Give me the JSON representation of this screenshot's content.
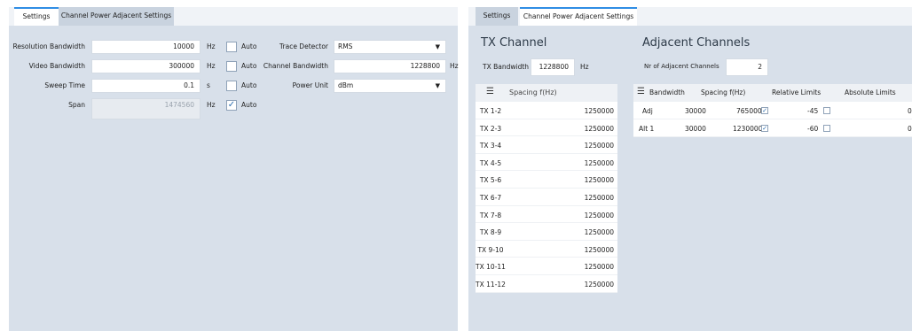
{
  "left": {
    "tabs": [
      "Settings",
      "Channel Power Adjacent Settings"
    ],
    "rbw": {
      "label": "Resolution Bandwidth",
      "value": "10000",
      "unit": "Hz",
      "auto_label": "Auto"
    },
    "vbw": {
      "label": "Video Bandwidth",
      "value": "300000",
      "unit": "Hz",
      "auto_label": "Auto"
    },
    "sweep": {
      "label": "Sweep Time",
      "value": "0.1",
      "unit": "s",
      "auto_label": "Auto"
    },
    "span": {
      "label": "Span",
      "value": "1474560",
      "unit": "Hz",
      "auto_label": "Auto"
    },
    "trace_detector": {
      "label": "Trace Detector",
      "value": "RMS"
    },
    "channel_bw": {
      "label": "Channel Bandwidth",
      "value": "1228800",
      "unit": "Hz"
    },
    "power_unit": {
      "label": "Power Unit",
      "value": "dBm"
    }
  },
  "right": {
    "tabs": [
      "Settings",
      "Channel Power Adjacent Settings"
    ],
    "tx_channel": {
      "title": "TX Channel",
      "bw_label": "TX Bandwidth",
      "bw_value": "1228800",
      "bw_unit": "Hz"
    },
    "adjacent": {
      "title": "Adjacent Channels",
      "nr_label": "Nr of Adjacent Channels",
      "nr_value": "2"
    },
    "tx_table": {
      "header": "Spacing f(Hz)",
      "rows": [
        {
          "name": "TX 1-2",
          "value": "1250000"
        },
        {
          "name": "TX 2-3",
          "value": "1250000"
        },
        {
          "name": "TX 3-4",
          "value": "1250000"
        },
        {
          "name": "TX 4-5",
          "value": "1250000"
        },
        {
          "name": "TX 5-6",
          "value": "1250000"
        },
        {
          "name": "TX 6-7",
          "value": "1250000"
        },
        {
          "name": "TX 7-8",
          "value": "1250000"
        },
        {
          "name": "TX 8-9",
          "value": "1250000"
        },
        {
          "name": "TX 9-10",
          "value": "1250000"
        },
        {
          "name": "TX 10-11",
          "value": "1250000"
        },
        {
          "name": "TX 11-12",
          "value": "1250000"
        }
      ]
    },
    "adj_table": {
      "headers": [
        "Bandwidth",
        "Spacing f(Hz)",
        "Relative Limits",
        "Absolute Limits"
      ],
      "rows": [
        {
          "name": "Adj",
          "bandwidth": "30000",
          "spacing": "765000",
          "relative": "-45",
          "absolute": "0"
        },
        {
          "name": "Alt 1",
          "bandwidth": "30000",
          "spacing": "1230000",
          "relative": "-60",
          "absolute": "0"
        }
      ]
    }
  },
  "icons": {
    "list": "list-icon",
    "check": "check-icon",
    "dropdown": "dropdown-arrow-icon"
  }
}
